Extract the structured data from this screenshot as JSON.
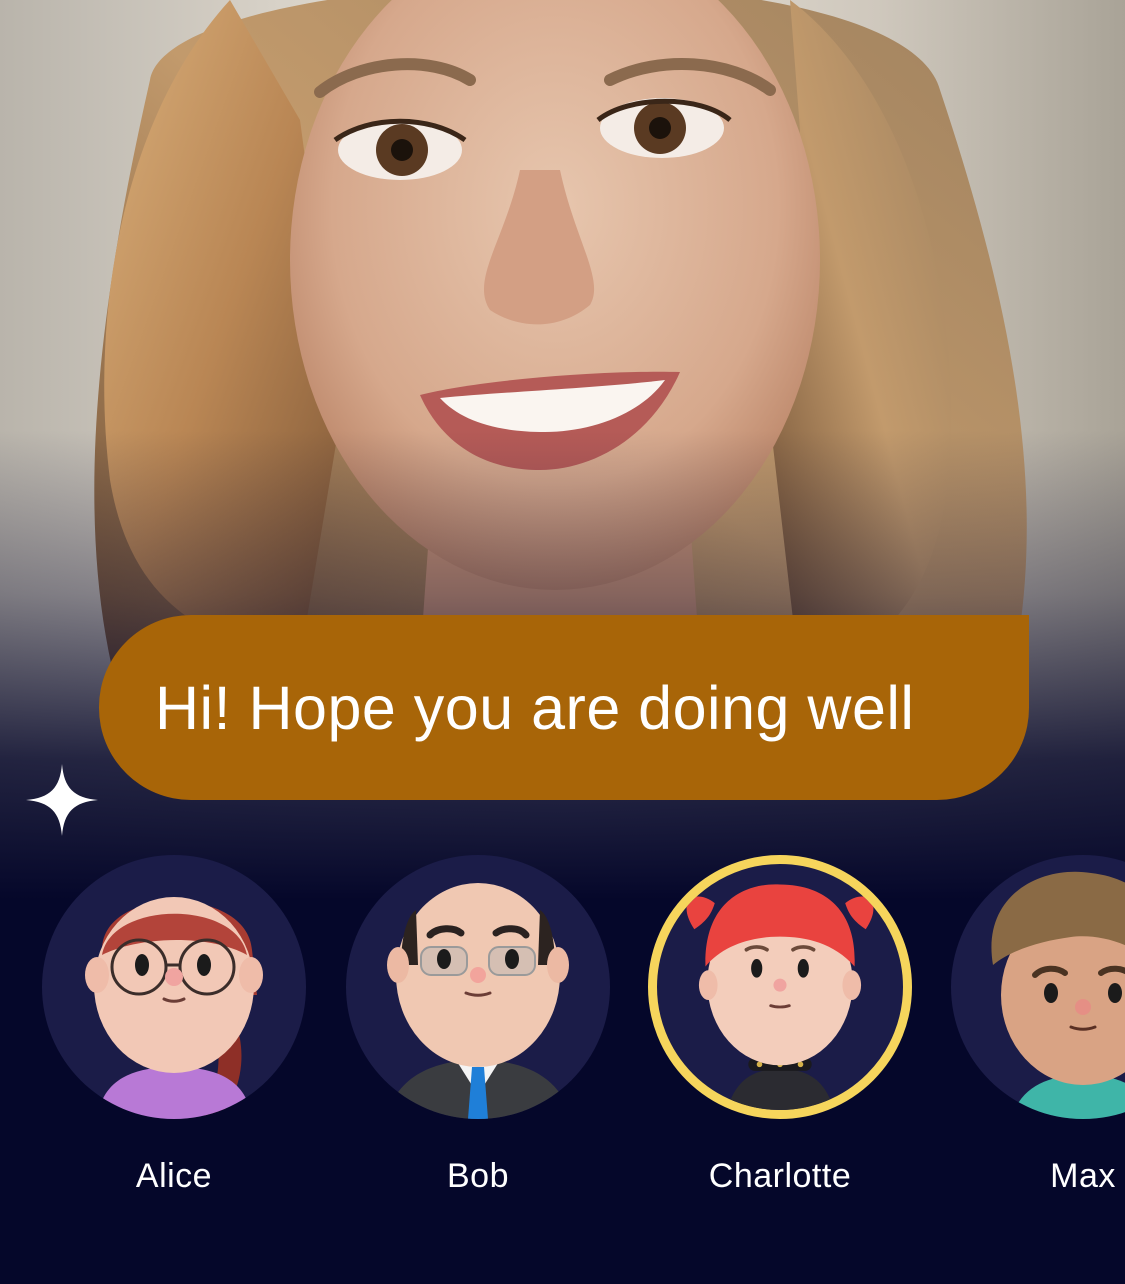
{
  "message": {
    "text": "Hi! Hope you are doing well"
  },
  "avatars": [
    {
      "name": "Alice",
      "selected": false
    },
    {
      "name": "Bob",
      "selected": false
    },
    {
      "name": "Charlotte",
      "selected": true
    },
    {
      "name": "Max",
      "selected": false
    }
  ],
  "colors": {
    "background": "#05072a",
    "bubble": "#a86508",
    "avatar_bg": "#1b1c48",
    "selected_ring": "#f6d55c"
  },
  "icons": {
    "sparkle": "sparkle-icon"
  }
}
